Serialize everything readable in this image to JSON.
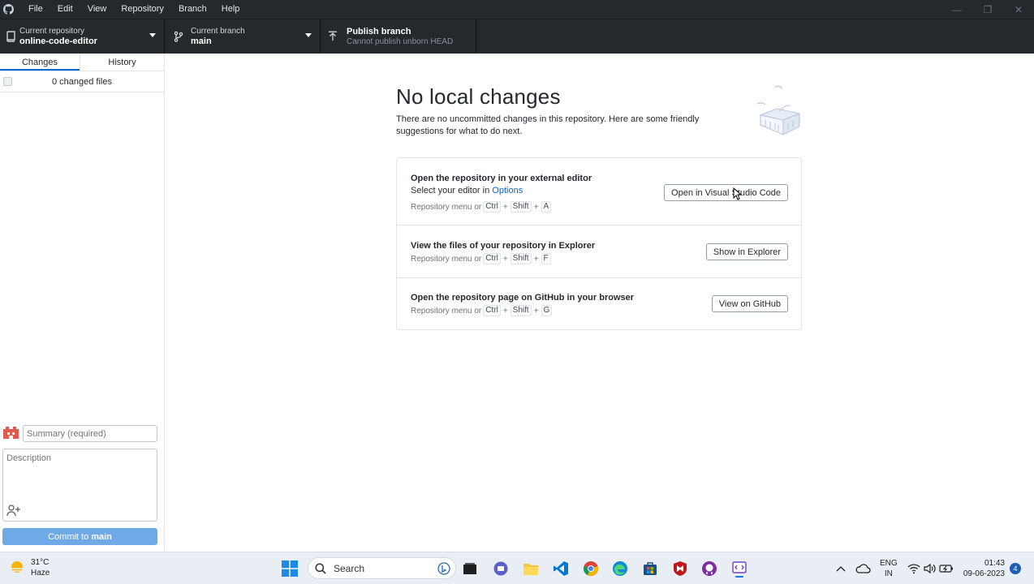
{
  "menu": [
    "File",
    "Edit",
    "View",
    "Repository",
    "Branch",
    "Help"
  ],
  "toolbar": {
    "repo_label": "Current repository",
    "repo_value": "online-code-editor",
    "branch_label": "Current branch",
    "branch_value": "main",
    "publish_label": "Publish branch",
    "publish_sub": "Cannot publish unborn HEAD"
  },
  "sidebar": {
    "tabs": [
      "Changes",
      "History"
    ],
    "active_tab": "Changes",
    "changed_files": "0 changed files",
    "summary_placeholder": "Summary (required)",
    "description_placeholder": "Description",
    "commit_prefix": "Commit to",
    "commit_branch": "main"
  },
  "main": {
    "title": "No local changes",
    "description": "There are no uncommitted changes in this repository. Here are some friendly suggestions for what to do next.",
    "suggestions": [
      {
        "title": "Open the repository in your external editor",
        "line_prefix": "Select your editor in ",
        "line_link": "Options",
        "keys_prefix": "Repository menu or",
        "keys": [
          "Ctrl",
          "Shift",
          "A"
        ],
        "button": "Open in Visual Studio Code"
      },
      {
        "title": "View the files of your repository in Explorer",
        "keys_prefix": "Repository menu or",
        "keys": [
          "Ctrl",
          "Shift",
          "F"
        ],
        "button": "Show in Explorer"
      },
      {
        "title": "Open the repository page on GitHub in your browser",
        "keys_prefix": "Repository menu or",
        "keys": [
          "Ctrl",
          "Shift",
          "G"
        ],
        "button": "View on GitHub"
      }
    ]
  },
  "taskbar": {
    "temperature": "31°C",
    "weather": "Haze",
    "search": "Search",
    "lang_top": "ENG",
    "lang_bottom": "IN",
    "time": "01:43",
    "date": "09-06-2023",
    "notifications": "4"
  },
  "colors": {
    "toolbar_bg": "#24292e",
    "accent": "#0366d6",
    "commit_button": "#6fa9e6"
  }
}
